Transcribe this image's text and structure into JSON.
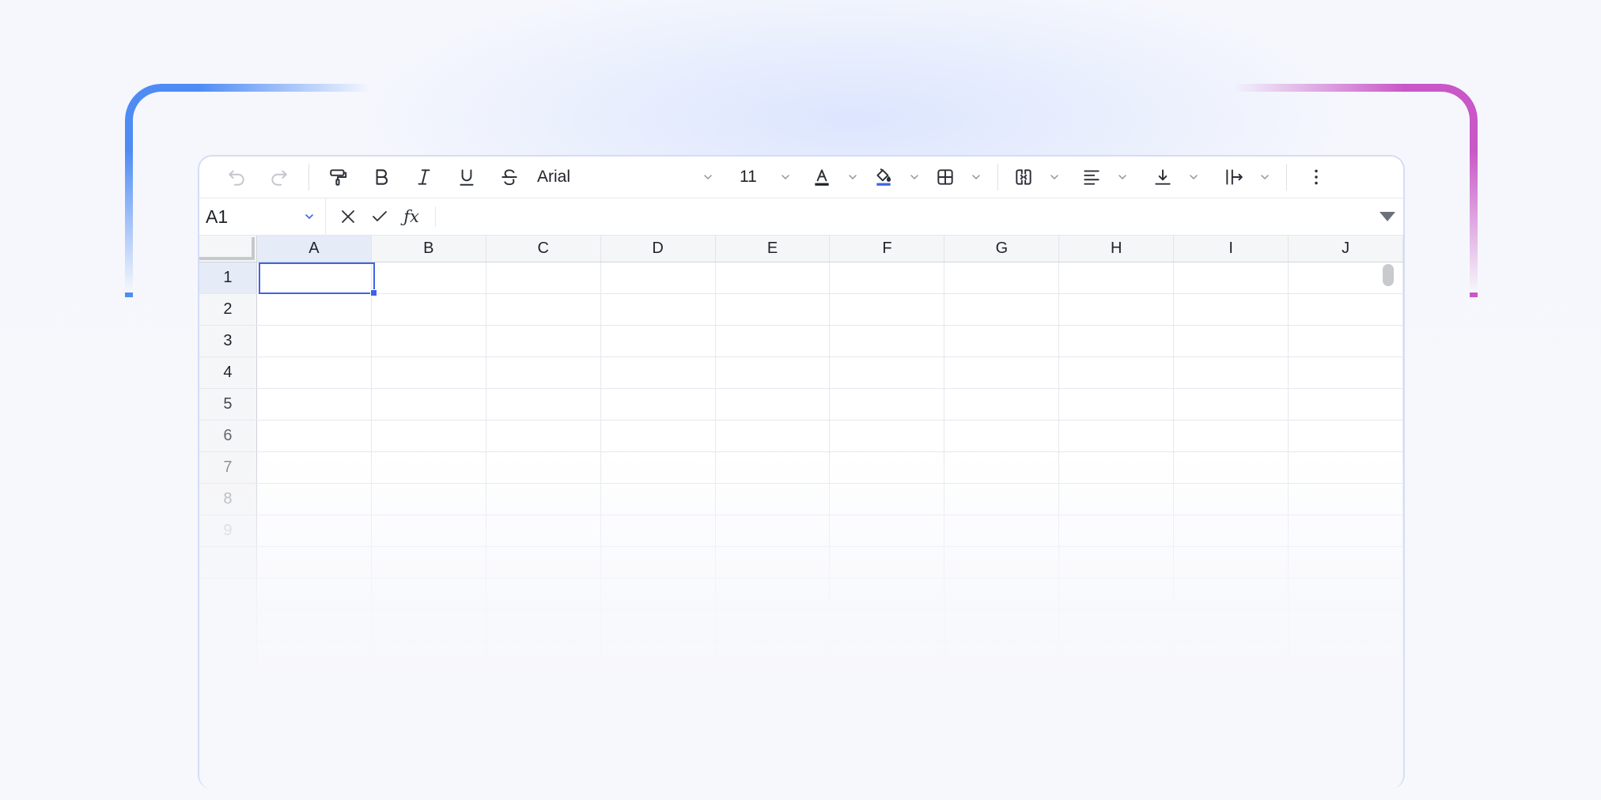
{
  "toolbar": {
    "undo": "undo-icon",
    "redo": "redo-icon",
    "format_painter": "format-painter-icon",
    "bold": "bold-icon",
    "italic": "italic-icon",
    "underline": "underline-icon",
    "strikethrough": "strikethrough-icon",
    "font_name": "Arial",
    "font_size": "11",
    "text_color": "#1f2329",
    "fill_color": "#3c64e6",
    "more": "more-vertical-icon"
  },
  "formula_bar": {
    "cell_ref": "A1",
    "fx_label": "ƒx",
    "value": ""
  },
  "grid": {
    "columns": [
      "A",
      "B",
      "C",
      "D",
      "E",
      "F",
      "G",
      "H",
      "I",
      "J"
    ],
    "rows": [
      "1",
      "2",
      "3",
      "4",
      "5",
      "6",
      "7",
      "8",
      "9",
      "",
      "",
      "",
      "",
      "",
      "",
      ""
    ],
    "selected_cell": "A1"
  },
  "colors": {
    "accent": "#3c64e6",
    "frame_left": "#4e8cf4",
    "frame_right": "#c957c7"
  }
}
